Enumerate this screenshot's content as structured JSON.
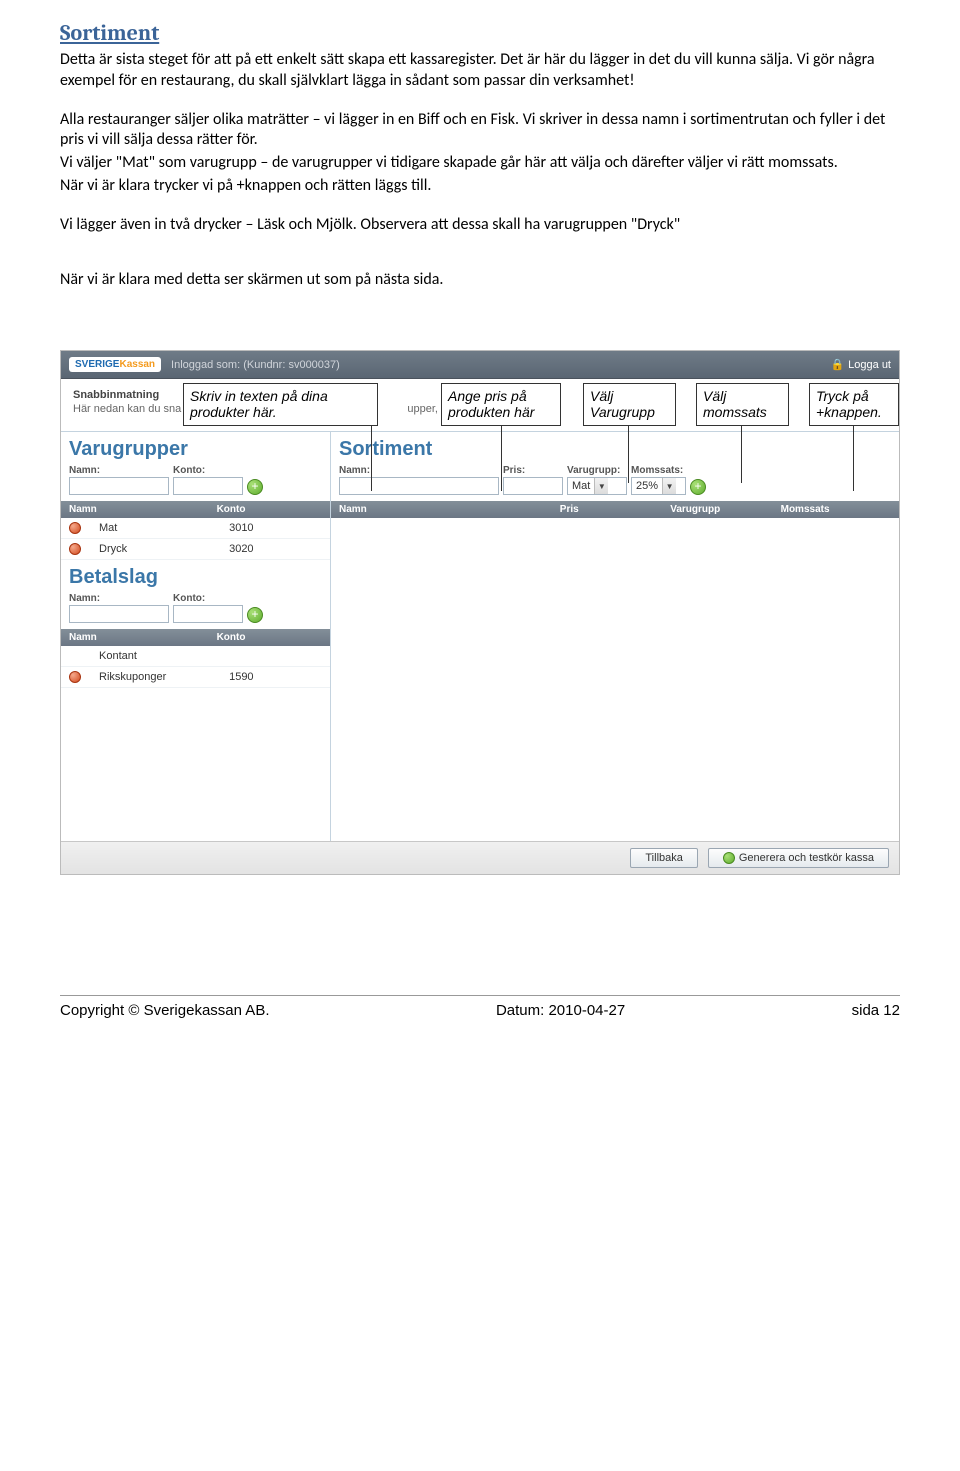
{
  "doc": {
    "section_title": "Sortiment",
    "p1": "Detta är sista steget för att på ett enkelt sätt skapa ett kassaregister. Det är här du lägger in det du vill kunna sälja. Vi gör några exempel för en restaurang, du skall självklart lägga in sådant som passar din verksamhet!",
    "p2": "Alla restauranger säljer olika maträtter – vi lägger in en Biff och en Fisk. Vi skriver in dessa namn i sortimentrutan och fyller i det pris vi vill sälja dessa rätter för.",
    "p3": "Vi väljer \"Mat\" som varugrupp – de varugrupper vi tidigare skapade går här att välja och därefter väljer vi rätt momssats.",
    "p4": "När vi är klara trycker vi på +knappen och rätten läggs till.",
    "p5": "Vi lägger även in två drycker – Läsk och Mjölk. Observera att dessa skall ha varugruppen \"Dryck\"",
    "p6": "När vi är klara med detta ser skärmen ut som på nästa sida."
  },
  "annotations": {
    "a1": "Skriv in texten på dina produkter här.",
    "a2": "Ange pris på produkten här",
    "a3": "Välj Varugrupp",
    "a4": "Välj momssats",
    "a5": "Tryck på +knappen."
  },
  "app": {
    "logo_part1": "SVERIGE",
    "logo_part2": "Kassan",
    "login_label": "Inloggad som: (Kundnr: sv000037)",
    "logout": "Logga ut",
    "snabb_title": "Snabbinmatning",
    "snabb_desc_a": "Här nedan kan du sna",
    "snabb_desc_b": "upper, dina betal",
    "varugrupper_title": "Varugrupper",
    "sortiment_title": "Sortiment",
    "betalslag_title": "Betalslag",
    "labels": {
      "namn": "Namn:",
      "konto": "Konto:",
      "pris": "Pris:",
      "varugrupp": "Varugrupp:",
      "momssats": "Momssats:"
    },
    "col": {
      "namn": "Namn",
      "konto": "Konto",
      "pris": "Pris",
      "varugrupp": "Varugrupp",
      "momssats": "Momssats"
    },
    "varugrupper_rows": [
      {
        "namn": "Mat",
        "konto": "3010"
      },
      {
        "namn": "Dryck",
        "konto": "3020"
      }
    ],
    "betalslag_rows": [
      {
        "namn": "Kontant",
        "konto": ""
      },
      {
        "namn": "Rikskuponger",
        "konto": "1590"
      }
    ],
    "sortiment_selected_vg": "Mat",
    "sortiment_selected_moms": "25%",
    "footer_back": "Tillbaka",
    "footer_generate": "Generera och testkör kassa"
  },
  "footer": {
    "copyright": "Copyright © Sverigekassan AB.",
    "date": "Datum:  2010-04-27",
    "page": "sida 12"
  }
}
